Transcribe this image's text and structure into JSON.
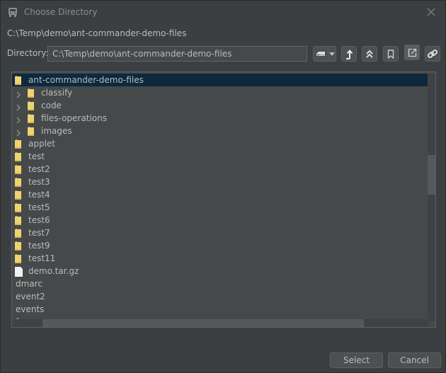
{
  "window": {
    "title": "Choose Directory",
    "icon": "ant-icon"
  },
  "current_path": "C:\\Temp\\demo\\ant-commander-demo-files",
  "directory": {
    "label": "Directory:",
    "value": "C:\\Temp\\demo\\ant-commander-demo-files"
  },
  "toolbar": {
    "buttons": [
      {
        "name": "drive-selector",
        "icon": "drive-icon"
      },
      {
        "name": "drive-dropdown",
        "icon": "caret-down-icon"
      },
      {
        "name": "parent-directory",
        "icon": "arrow-up-icon"
      },
      {
        "name": "root-directory",
        "icon": "double-chevron-up-icon"
      },
      {
        "name": "bookmark",
        "icon": "bookmark-icon"
      },
      {
        "name": "open-external",
        "icon": "external-link-icon",
        "active": true
      },
      {
        "name": "link",
        "icon": "link-icon"
      }
    ]
  },
  "tree": {
    "rows": [
      {
        "label": "ant-commander-demo-files",
        "type": "folder",
        "level": 0,
        "expandable": false,
        "selected": true
      },
      {
        "label": "classify",
        "type": "folder",
        "level": 1,
        "expandable": true
      },
      {
        "label": "code",
        "type": "folder",
        "level": 1,
        "expandable": true
      },
      {
        "label": "files-operations",
        "type": "folder",
        "level": 1,
        "expandable": true
      },
      {
        "label": "images",
        "type": "folder",
        "level": 1,
        "expandable": true
      },
      {
        "label": "applet",
        "type": "folder",
        "level": 0
      },
      {
        "label": "test",
        "type": "folder",
        "level": 0
      },
      {
        "label": "test2",
        "type": "folder",
        "level": 0
      },
      {
        "label": "test3",
        "type": "folder",
        "level": 0
      },
      {
        "label": "test4",
        "type": "folder",
        "level": 0
      },
      {
        "label": "test5",
        "type": "folder",
        "level": 0
      },
      {
        "label": "test6",
        "type": "folder",
        "level": 0
      },
      {
        "label": "test7",
        "type": "folder",
        "level": 0
      },
      {
        "label": "test9",
        "type": "folder",
        "level": 0
      },
      {
        "label": "test11",
        "type": "folder",
        "level": 0
      },
      {
        "label": "demo.tar.gz",
        "type": "file",
        "level": 0
      },
      {
        "label": "dmarc",
        "type": "none",
        "level": -1
      },
      {
        "label": "event2",
        "type": "none",
        "level": -1
      },
      {
        "label": "events",
        "type": "none",
        "level": -1
      },
      {
        "label": "f...",
        "type": "none",
        "level": -1,
        "clipped": true
      }
    ]
  },
  "buttons": {
    "select": "Select",
    "cancel": "Cancel"
  },
  "colors": {
    "background": "#3c3f41",
    "panel": "#45494a",
    "selection": "#0d293e",
    "folder": "#f0d36e",
    "text": "#bbbbbb"
  }
}
